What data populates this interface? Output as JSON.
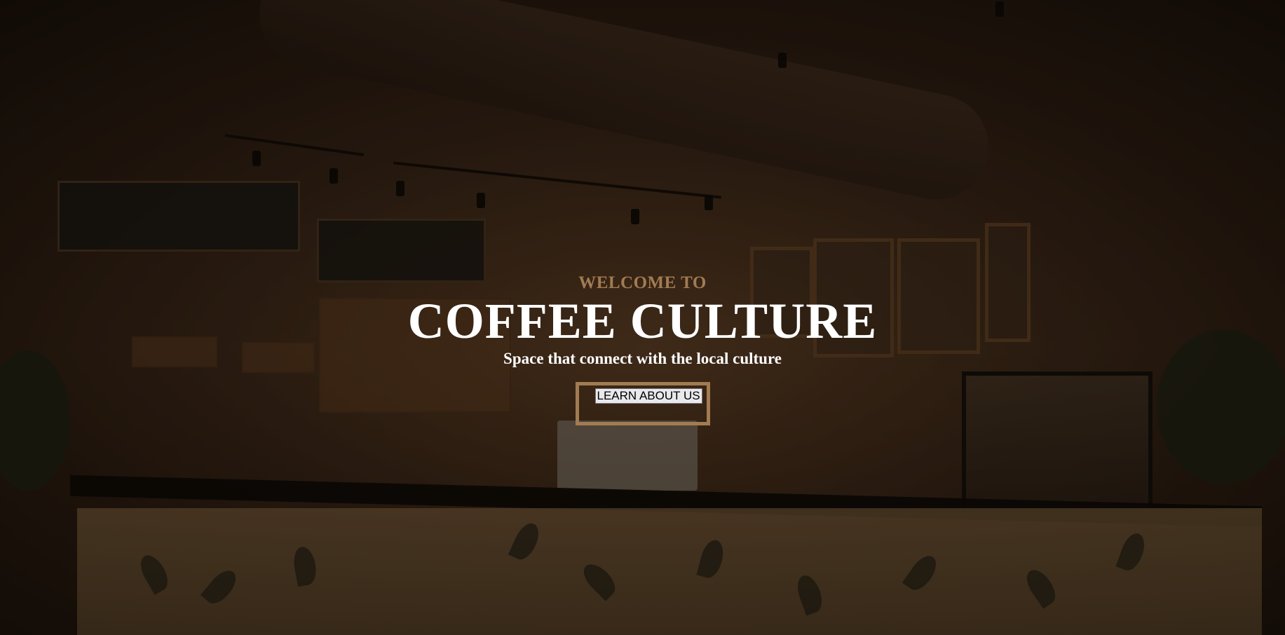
{
  "hero": {
    "eyebrow": "WELCOME TO",
    "title": "COFFEE CULTURE",
    "subtitle": "Space that connect with the local culture",
    "cta_label": "LEARN ABOUT US"
  },
  "colors": {
    "accent": "#a27b52",
    "title_text": "#ffffff",
    "background_dark": "#1a120c"
  },
  "background_image": {
    "subject": "dimly lit coffee shop interior with counter, chalkboard menus and display case"
  }
}
